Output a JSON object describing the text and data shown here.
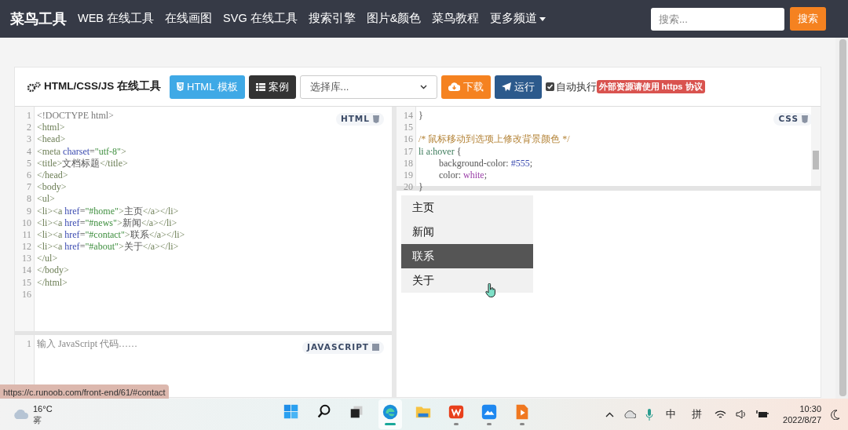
{
  "navbar": {
    "brand": "菜鸟工具",
    "links": [
      {
        "label": "WEB 在线工具",
        "dropdown": false
      },
      {
        "label": "在线画图",
        "dropdown": false
      },
      {
        "label": "SVG 在线工具",
        "dropdown": false
      },
      {
        "label": "搜索引擎",
        "dropdown": false
      },
      {
        "label": "图片&颜色",
        "dropdown": false
      },
      {
        "label": "菜鸟教程",
        "dropdown": false
      },
      {
        "label": "更多频道",
        "dropdown": true
      }
    ],
    "search": {
      "placeholder": "搜索..."
    },
    "search_button": "搜索"
  },
  "toolbar": {
    "title": "HTML/CSS/JS 在线工具",
    "buttons": [
      {
        "kind": "template",
        "label": "HTML 模板"
      },
      {
        "kind": "examples",
        "label": "案例"
      }
    ],
    "library_select": {
      "placeholder": "选择库..."
    },
    "actions": [
      {
        "kind": "download",
        "label": "下载"
      },
      {
        "kind": "run",
        "label": "运行"
      }
    ],
    "auto_run": {
      "label": "自动执行",
      "checked": true
    },
    "notice": "外部资源请使用 https 协议"
  },
  "html_editor": {
    "label": "HTML",
    "lines": [
      {
        "number": "1",
        "tokens": [
          {
            "kind": "meta",
            "text": "<!DOCTYPE html>"
          }
        ]
      },
      {
        "number": "2",
        "tokens": [
          {
            "kind": "tag",
            "text": "<html>"
          }
        ]
      },
      {
        "number": "3",
        "tokens": [
          {
            "kind": "tag",
            "text": "<head>"
          }
        ]
      },
      {
        "number": "4",
        "tokens": [
          {
            "kind": "tag",
            "text": "<meta "
          },
          {
            "kind": "attr",
            "text": "charset"
          },
          {
            "kind": "text",
            "text": "="
          },
          {
            "kind": "string",
            "text": "\"utf-8\""
          },
          {
            "kind": "tag",
            "text": ">"
          }
        ]
      },
      {
        "number": "5",
        "tokens": [
          {
            "kind": "tag",
            "text": "<title>"
          },
          {
            "kind": "text",
            "text": "文档标题"
          },
          {
            "kind": "tag",
            "text": "</title>"
          }
        ]
      },
      {
        "number": "6",
        "tokens": [
          {
            "kind": "tag",
            "text": "</head>"
          }
        ]
      },
      {
        "number": "7",
        "tokens": [
          {
            "kind": "tag",
            "text": "<body>"
          }
        ]
      },
      {
        "number": "8",
        "tokens": [
          {
            "kind": "tag",
            "text": "<ul>"
          }
        ]
      },
      {
        "number": "9",
        "tokens": [
          {
            "kind": "tag",
            "text": "<li><a "
          },
          {
            "kind": "attr",
            "text": "href"
          },
          {
            "kind": "text",
            "text": "="
          },
          {
            "kind": "string",
            "text": "\"#home\""
          },
          {
            "kind": "tag",
            "text": ">"
          },
          {
            "kind": "text",
            "text": "主页"
          },
          {
            "kind": "tag",
            "text": "</a></li>"
          }
        ]
      },
      {
        "number": "10",
        "tokens": [
          {
            "kind": "tag",
            "text": "<li><a "
          },
          {
            "kind": "attr",
            "text": "href"
          },
          {
            "kind": "text",
            "text": "="
          },
          {
            "kind": "string",
            "text": "\"#news\""
          },
          {
            "kind": "tag",
            "text": ">"
          },
          {
            "kind": "text",
            "text": "新闻"
          },
          {
            "kind": "tag",
            "text": "</a></li>"
          }
        ]
      },
      {
        "number": "11",
        "tokens": [
          {
            "kind": "tag",
            "text": "<li><a "
          },
          {
            "kind": "attr",
            "text": "href"
          },
          {
            "kind": "text",
            "text": "="
          },
          {
            "kind": "string",
            "text": "\"#contact\""
          },
          {
            "kind": "tag",
            "text": ">"
          },
          {
            "kind": "text",
            "text": "联系"
          },
          {
            "kind": "tag",
            "text": "</a></li>"
          }
        ]
      },
      {
        "number": "12",
        "tokens": [
          {
            "kind": "tag",
            "text": "<li><a "
          },
          {
            "kind": "attr",
            "text": "href"
          },
          {
            "kind": "text",
            "text": "="
          },
          {
            "kind": "string",
            "text": "\"#about\""
          },
          {
            "kind": "tag",
            "text": ">"
          },
          {
            "kind": "text",
            "text": "关于"
          },
          {
            "kind": "tag",
            "text": "</a></li>"
          }
        ]
      },
      {
        "number": "13",
        "tokens": [
          {
            "kind": "tag",
            "text": "</ul>"
          }
        ]
      },
      {
        "number": "14",
        "tokens": [
          {
            "kind": "tag",
            "text": "</body>"
          }
        ]
      },
      {
        "number": "15",
        "tokens": [
          {
            "kind": "tag",
            "text": "</html>"
          }
        ]
      },
      {
        "number": "16"
      }
    ]
  },
  "css_editor": {
    "label": "CSS",
    "lines": [
      {
        "number": "14",
        "tokens": [
          {
            "kind": "text",
            "text": "}"
          }
        ]
      },
      {
        "number": "15"
      },
      {
        "number": "16",
        "tokens": [
          {
            "kind": "comment",
            "text": "/* 鼠标移动到选项上修改背景颜色 */"
          }
        ]
      },
      {
        "number": "17",
        "tokens": [
          {
            "kind": "selector",
            "text": "li a:hover"
          },
          {
            "kind": "text",
            "text": " {"
          }
        ]
      },
      {
        "number": "18",
        "indented": true,
        "tokens": [
          {
            "kind": "text",
            "text": "background-color: "
          },
          {
            "kind": "number",
            "text": "#555"
          },
          {
            "kind": "text",
            "text": ";"
          }
        ]
      },
      {
        "number": "19",
        "indented": true,
        "tokens": [
          {
            "kind": "text",
            "text": "color: "
          },
          {
            "kind": "keyword",
            "text": "white"
          },
          {
            "kind": "text",
            "text": ";"
          }
        ]
      },
      {
        "number": "20",
        "tokens": [
          {
            "kind": "text",
            "text": "}"
          }
        ]
      }
    ]
  },
  "js_editor": {
    "label": "JAVASCRIPT",
    "lines": [
      {
        "number": "1"
      }
    ],
    "placeholder": "输入 JavaScript 代码……"
  },
  "result": {
    "items": [
      {
        "label": "主页",
        "hovered": false
      },
      {
        "label": "新闻",
        "hovered": false
      },
      {
        "label": "联系",
        "hovered": true
      },
      {
        "label": "关于",
        "hovered": false
      }
    ]
  },
  "status_url": "https://c.runoob.com/front-end/61/#contact",
  "taskbar": {
    "weather": {
      "temperature": "16°C",
      "condition": "雾"
    },
    "apps": [
      {
        "kind": "start",
        "running": false,
        "active": false
      },
      {
        "kind": "search",
        "running": false,
        "active": false
      },
      {
        "kind": "taskview",
        "running": false,
        "active": false
      },
      {
        "kind": "edge",
        "running": true,
        "active": true
      },
      {
        "kind": "folder",
        "running": false,
        "active": false
      },
      {
        "kind": "wps",
        "running": true,
        "active": false
      },
      {
        "kind": "lanxin",
        "running": true,
        "active": false
      },
      {
        "kind": "player",
        "running": true,
        "active": false
      }
    ],
    "input_method": [
      "中",
      "拼"
    ],
    "time": "10:30",
    "date": "2022/8/27"
  }
}
